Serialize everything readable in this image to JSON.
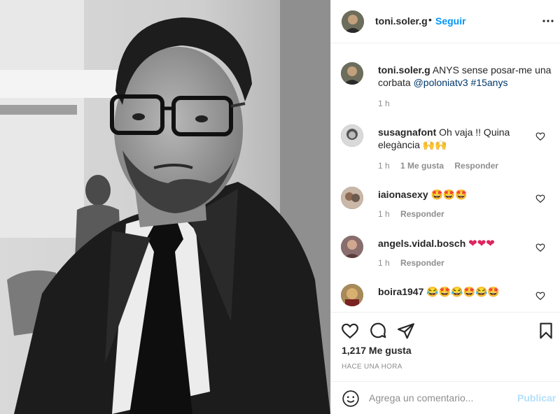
{
  "post": {
    "username": "toni.soler.g",
    "separator": "•",
    "follow_label": "Seguir",
    "more_icon": "more-horizontal-icon"
  },
  "caption": {
    "username": "toni.soler.g",
    "text": "ANYS sense posar-me una corbata",
    "mention": "@poloniatv3",
    "hashtag": "#15anys",
    "time": "1 h"
  },
  "comments": [
    {
      "username": "susagnafont",
      "text": "Oh vaja !! Quina elegància",
      "emojis": [
        "raising-hands",
        "raising-hands"
      ],
      "time": "1 h",
      "likes": "1 Me gusta",
      "reply": "Responder"
    },
    {
      "username": "iaionasexy",
      "text": "",
      "emojis": [
        "star-struck",
        "star-struck",
        "star-struck"
      ],
      "time": "1 h",
      "reply": "Responder"
    },
    {
      "username": "angels.vidal.bosch",
      "text": "",
      "emojis": [
        "red-heart",
        "red-heart",
        "red-heart"
      ],
      "time": "1 h",
      "reply": "Responder"
    },
    {
      "username": "boira1947",
      "text": "",
      "emojis": [
        "laughing",
        "star-struck",
        "laughing",
        "star-struck",
        "laughing",
        "star-struck"
      ]
    }
  ],
  "actions": {
    "likes": "1,217 Me gusta",
    "when": "HACE UNA HORA"
  },
  "add_comment": {
    "placeholder": "Agrega un comentario...",
    "publish_label": "Publicar"
  },
  "colors": {
    "link": "#0095f6",
    "mention": "#00376b",
    "meta": "#8e8e8e",
    "publish_disabled": "#b2dffc"
  }
}
